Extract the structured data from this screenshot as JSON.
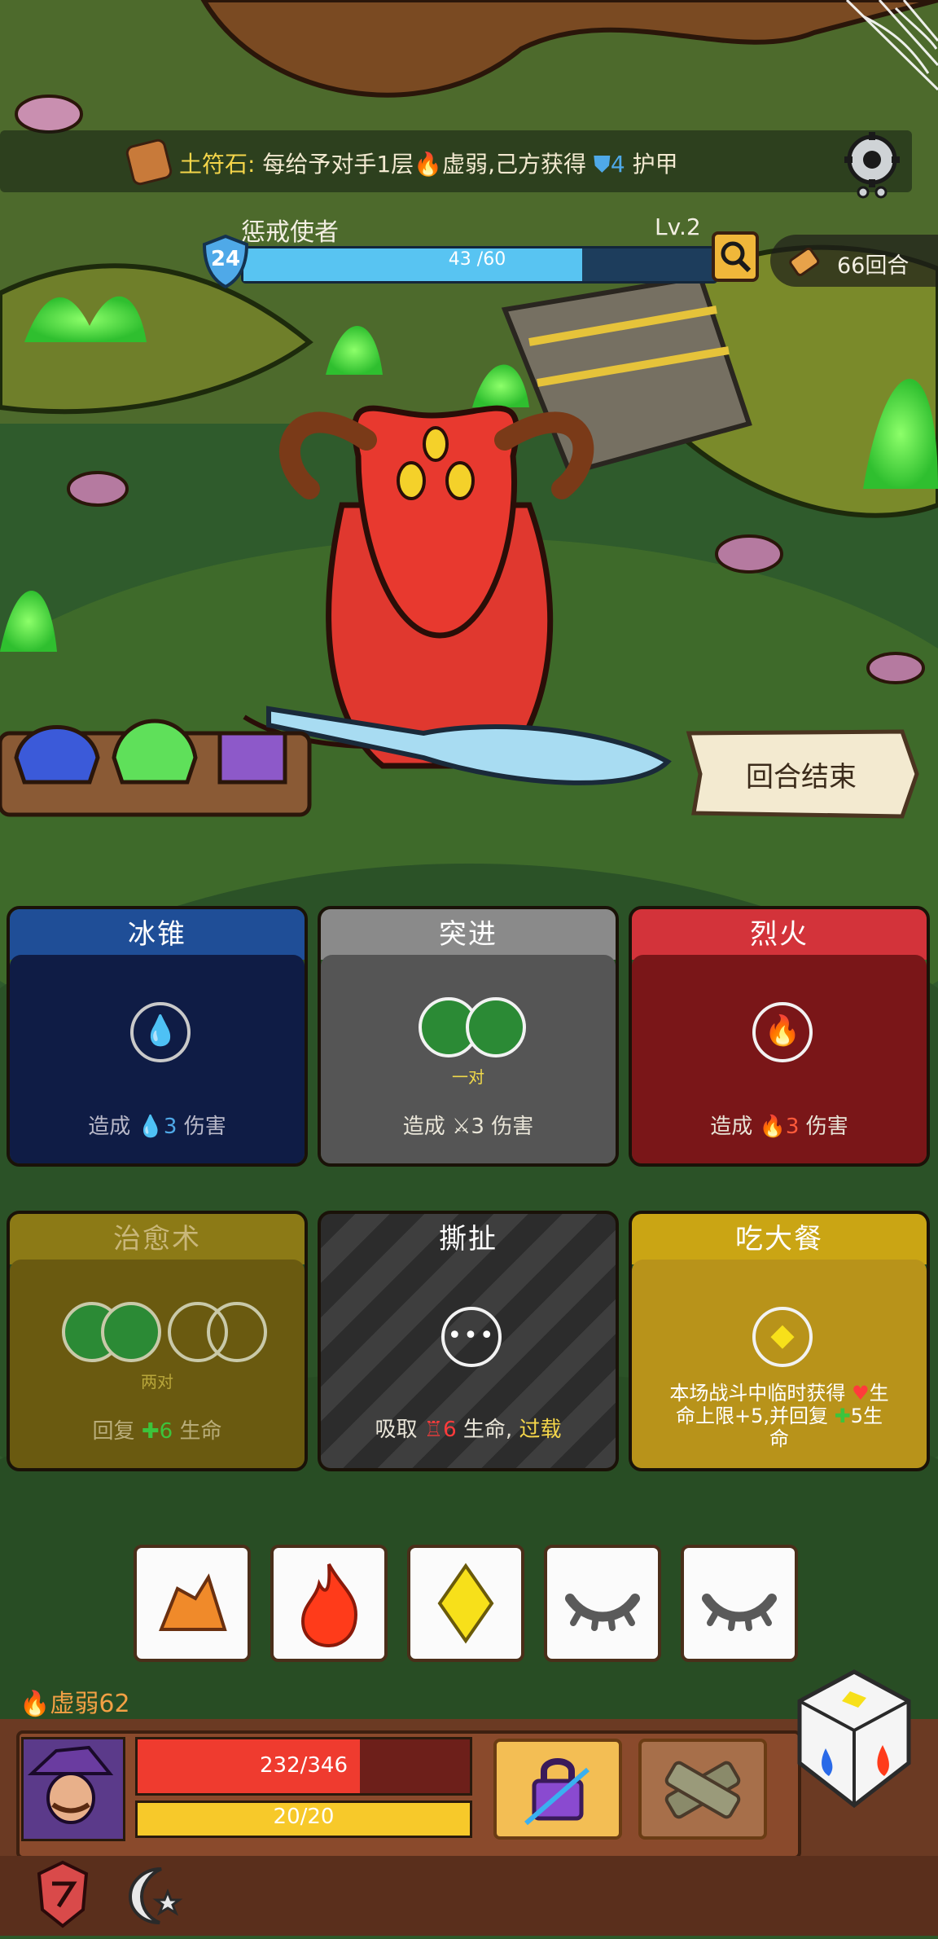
{
  "relic": {
    "name": "土符石:",
    "text_a": "每给予对手1层",
    "status": "虚弱",
    "text_b": ",己方获得",
    "armor_value": "4",
    "armor_label": "护甲"
  },
  "enemy": {
    "name": "惩戒使者",
    "level": "Lv.2",
    "armor": "24",
    "hp_text": "43 /60",
    "hp_fraction": 0.717
  },
  "turn_counter": "66回合",
  "end_turn_label": "回合结束",
  "cards": [
    {
      "title": "冰锥",
      "desc_a": "造成",
      "value": "3",
      "desc_b": "伤害",
      "sub": ""
    },
    {
      "title": "突进",
      "desc_a": "造成",
      "value": "3",
      "desc_b": "伤害",
      "sub": "一对"
    },
    {
      "title": "烈火",
      "desc_a": "造成",
      "value": "3",
      "desc_b": "伤害",
      "sub": ""
    },
    {
      "title": "治愈术",
      "desc_a": "回复",
      "value": "6",
      "desc_b": "生命",
      "sub": "两对"
    },
    {
      "title": "撕扯",
      "desc_a": "吸取",
      "value": "6",
      "desc_b": "生命,",
      "extra": "过载",
      "sub": ""
    },
    {
      "title": "吃大餐",
      "line1": "本场战斗中临时获得",
      "line1b": "生",
      "line2": "命上限+5,并回复",
      "line2b": "5生",
      "line3": "命"
    }
  ],
  "player": {
    "status_label": "虚弱62",
    "hp_text": "232/346",
    "hp_fraction": 0.67,
    "energy_text": "20/20",
    "energy_fraction": 1.0
  },
  "colors": {
    "enemy_hp": "#58c4f2",
    "player_hp": "#ef3b2f",
    "energy": "#f7c92a"
  }
}
